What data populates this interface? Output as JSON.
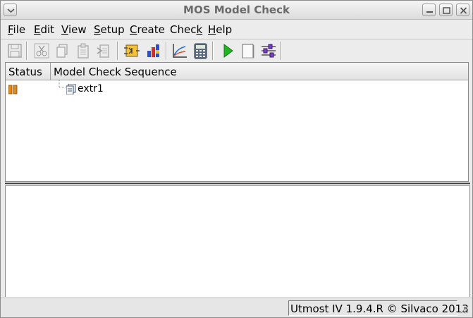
{
  "window": {
    "title": "MOS Model Check"
  },
  "menu": [
    {
      "pre": "",
      "key": "F",
      "post": "ile"
    },
    {
      "pre": "",
      "key": "E",
      "post": "dit"
    },
    {
      "pre": "",
      "key": "V",
      "post": "iew"
    },
    {
      "pre": "",
      "key": "S",
      "post": "etup"
    },
    {
      "pre": "",
      "key": "C",
      "post": "reate"
    },
    {
      "pre": "Chec",
      "key": "k",
      "post": ""
    },
    {
      "pre": "",
      "key": "H",
      "post": "elp"
    }
  ],
  "toolbar": {
    "icons": [
      "save-icon",
      "cut-icon",
      "copy-icon",
      "paste-icon",
      "delete-icon",
      "circuit-icon",
      "chart-bars-icon",
      "plot-axes-icon",
      "calculator-icon",
      "run-icon",
      "page-icon",
      "settings-sliders-icon"
    ]
  },
  "table": {
    "headers": {
      "status": "Status",
      "sequence": "Model Check Sequence"
    },
    "rows": [
      {
        "status_icon": "paused-status-icon",
        "name": "extr1"
      }
    ]
  },
  "statusbar": {
    "text": "Utmost IV 1.9.4.R © Silvaco 2013"
  },
  "colors": {
    "run_green": "#22b422",
    "pause_orange": "#e08a1e"
  }
}
